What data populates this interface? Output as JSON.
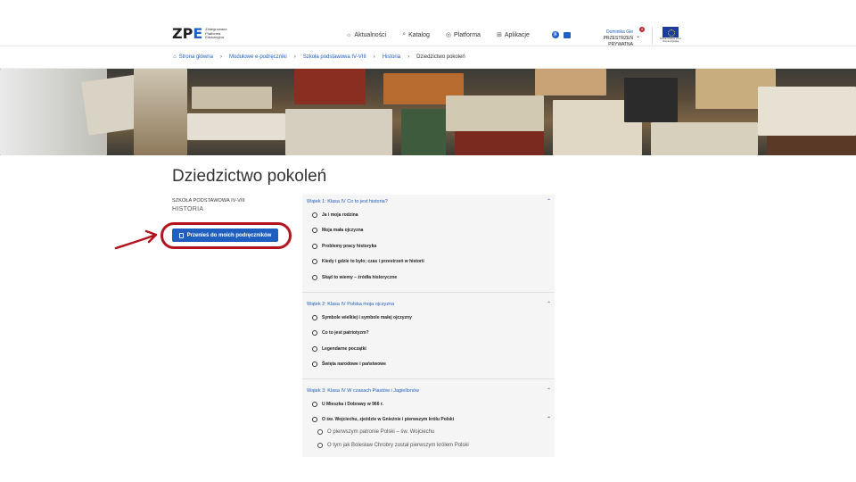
{
  "header": {
    "logo_mark": "ZPE",
    "logo_text": [
      "Zintegrowana",
      "Platforma",
      "Edukacyjna"
    ],
    "nav": [
      {
        "label": "Aktualności",
        "icon": "news-icon"
      },
      {
        "label": "Katalog",
        "icon": "search-icon"
      },
      {
        "label": "Platforma",
        "icon": "globe-icon"
      },
      {
        "label": "Aplikacje",
        "icon": "grid-icon"
      }
    ],
    "user_name": "Dominika Gie",
    "user_space": "PRZESTRZEŃ PRYWATNA",
    "notification_count": "4",
    "eu_text": "Dofinansowane przez Unię Europejską"
  },
  "breadcrumb": [
    "Strona główna",
    "Modułowe e-podręczniki",
    "Szkoła podstawowa IV-VIII",
    "Historia",
    "Dziedzictwo pokoleń"
  ],
  "page": {
    "title": "Dziedzictwo pokoleń",
    "school": "SZKOŁA PODSTAWOWA IV-VIII",
    "subject": "HISTORIA",
    "move_button": "Przenieś do moich podręczników"
  },
  "sections": [
    {
      "title": "Wątek 1: Klasa IV Co to jest historia?",
      "items": [
        "Ja i moja rodzina",
        "Moja mała ojczyzna",
        "Problemy pracy historyka",
        "Kiedy i gdzie to było; czas i przestrzeń w historii",
        "Skąd to wiemy – źródła historyczne"
      ]
    },
    {
      "title": "Wątek 2: Klasa IV Polska moja ojczyzna",
      "items": [
        "Symbole wielkiej i symbole małej ojczyzny",
        "Co to jest patriotyzm?",
        "Legendarne początki",
        "Święta narodowe i państwowe"
      ]
    },
    {
      "title": "Wątek 3: Klasa IV W czasach Piastów i Jagiellonów",
      "items": [
        "U Mieszka i Dobrawy w 966 r.",
        "O św. Wojciechu, zjeździe w Gnieźnie i pierwszym królu Polski"
      ],
      "sub_items": [
        "O pierwszym patronie Polski – św. Wojciechu",
        "O tym jak Bolesław Chrobry został pierwszym królem Polski"
      ]
    }
  ]
}
